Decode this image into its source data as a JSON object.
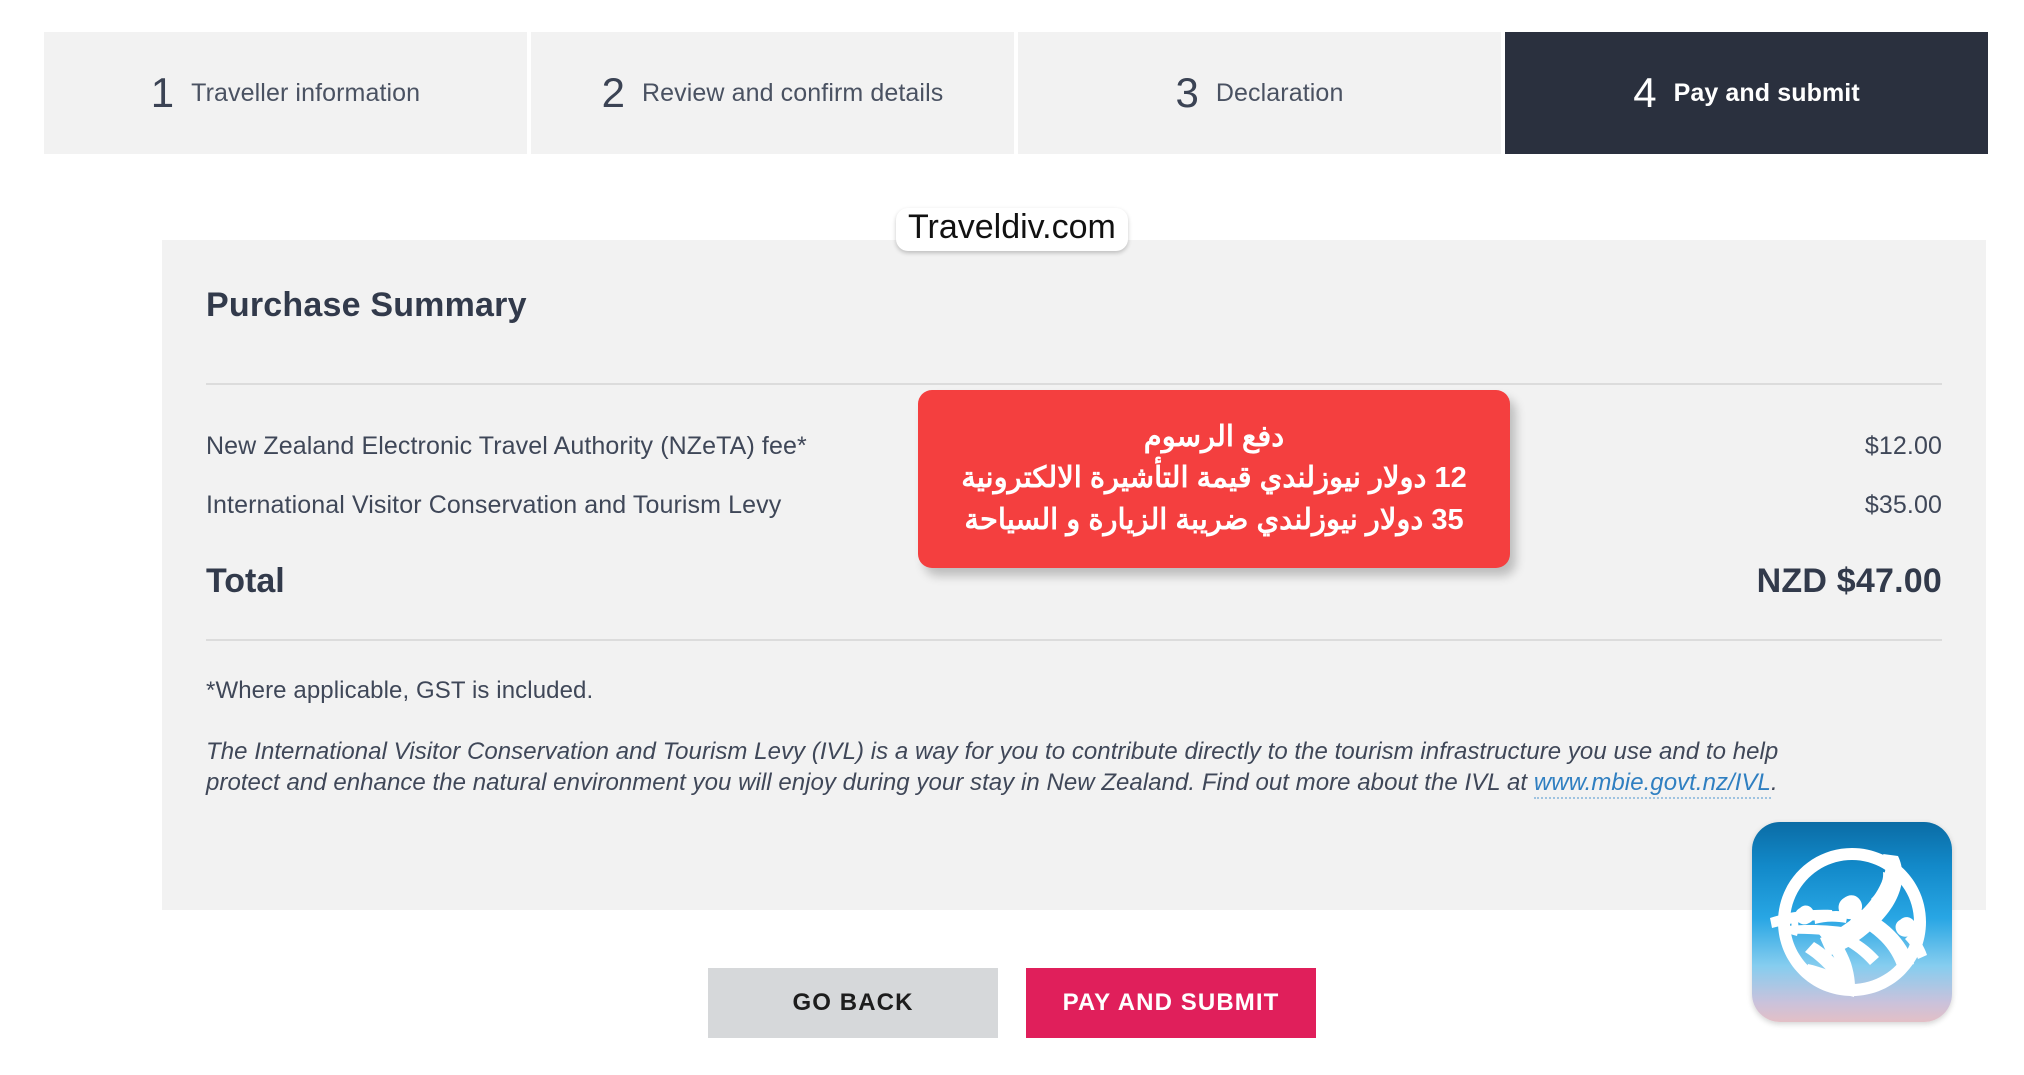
{
  "stepper": {
    "steps": [
      {
        "number": "1",
        "label": "Traveller information",
        "active": false
      },
      {
        "number": "2",
        "label": "Review and confirm details",
        "active": false
      },
      {
        "number": "3",
        "label": "Declaration",
        "active": false
      },
      {
        "number": "4",
        "label": "Pay and submit",
        "active": true
      }
    ]
  },
  "watermark": {
    "text": "Traveldiv.com"
  },
  "card": {
    "title": "Purchase Summary",
    "fees": [
      {
        "label": "New Zealand Electronic Travel Authority (NZeTA) fee*",
        "amount": "$12.00"
      },
      {
        "label": "International Visitor Conservation and Tourism Levy",
        "amount": "$35.00"
      }
    ],
    "total_label": "Total",
    "total_amount": "NZD $47.00",
    "gst_note": "*Where applicable, GST is included.",
    "ivl_text_before": "The International Visitor Conservation and Tourism Levy (IVL) is a way for you to contribute directly to the tourism infrastructure you use and to help protect and enhance the natural environment you will enjoy during your stay in New Zealand. Find out more about the IVL at ",
    "ivl_link": "www.mbie.govt.nz/IVL",
    "ivl_text_after": "."
  },
  "callout": {
    "lines": [
      "دفع الرسوم",
      "12 دولار نيوزلندي قيمة التأشيرة الالكترونية",
      "35 دولار نيوزلندي ضريبة الزيارة و السياحة"
    ],
    "background_color": "#f43f3f",
    "text_color": "#ffffff"
  },
  "actions": {
    "back_label": "GO BACK",
    "pay_label": "PAY AND SUBMIT",
    "back_color": "#d6d8da",
    "pay_color": "#e01f5b"
  },
  "app_icon": {
    "name": "airplane-circle-app-icon"
  },
  "colors": {
    "active_step_bg": "#2a303e",
    "step_bg": "#f2f2f2",
    "card_bg": "#f2f2f2",
    "text": "#323a4b",
    "link": "#2f7fc1"
  }
}
